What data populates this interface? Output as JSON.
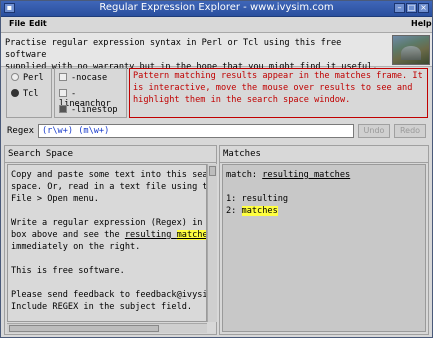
{
  "window": {
    "title": "Regular Expression Explorer - www.ivysim.com",
    "menu": {
      "file": "File",
      "edit": "Edit",
      "help": "Help"
    }
  },
  "info": {
    "line1": "Practise regular expression syntax in Perl or Tcl using this free software",
    "line2": "supplied with no warranty but in the hope that you might find it useful."
  },
  "options": {
    "languages": [
      {
        "label": "Perl",
        "selected": false
      },
      {
        "label": "Tcl",
        "selected": true
      }
    ],
    "flags": [
      {
        "label": "-nocase",
        "checked": false
      },
      {
        "label": "-lineanchor",
        "checked": false
      },
      {
        "label": "-linestop",
        "checked": true
      }
    ]
  },
  "message": {
    "line1": "Pattern matching results appear in the matches frame. It",
    "line2": "is interactive, move the mouse over results to see and",
    "line3": "highlight them in the search space window."
  },
  "regex": {
    "label": "Regex",
    "value": "(r\\w+) (m\\w+)",
    "undo": "Undo",
    "redo": "Redo"
  },
  "search_space": {
    "title": "Search Space",
    "l1": "Copy and paste some text into this sear",
    "l2": "space. Or, read in a text file using th",
    "l3": "File > Open menu.",
    "l4": "Write a regular expression (Regex) in t",
    "l5a": "box above and see the ",
    "l5b": "resulting",
    "l5c": " ",
    "l5d": "matches",
    "l6": "immediately on the right.",
    "l7": "This is free software.",
    "l8": "Please send feedback to feedback@ivysim",
    "l9": "Include REGEX in the subject field."
  },
  "matches": {
    "title": "Matches",
    "match_label": "match: ",
    "match_value": "resulting matches",
    "r1_index": "1: ",
    "r1_value": "resulting",
    "r2_index": "2: ",
    "r2_value": "matches"
  },
  "colors": {
    "titlebar": "#2f56a8",
    "message_red": "#c00000",
    "regex_blue": "#1a3ccc",
    "highlight": "#ffff40"
  }
}
